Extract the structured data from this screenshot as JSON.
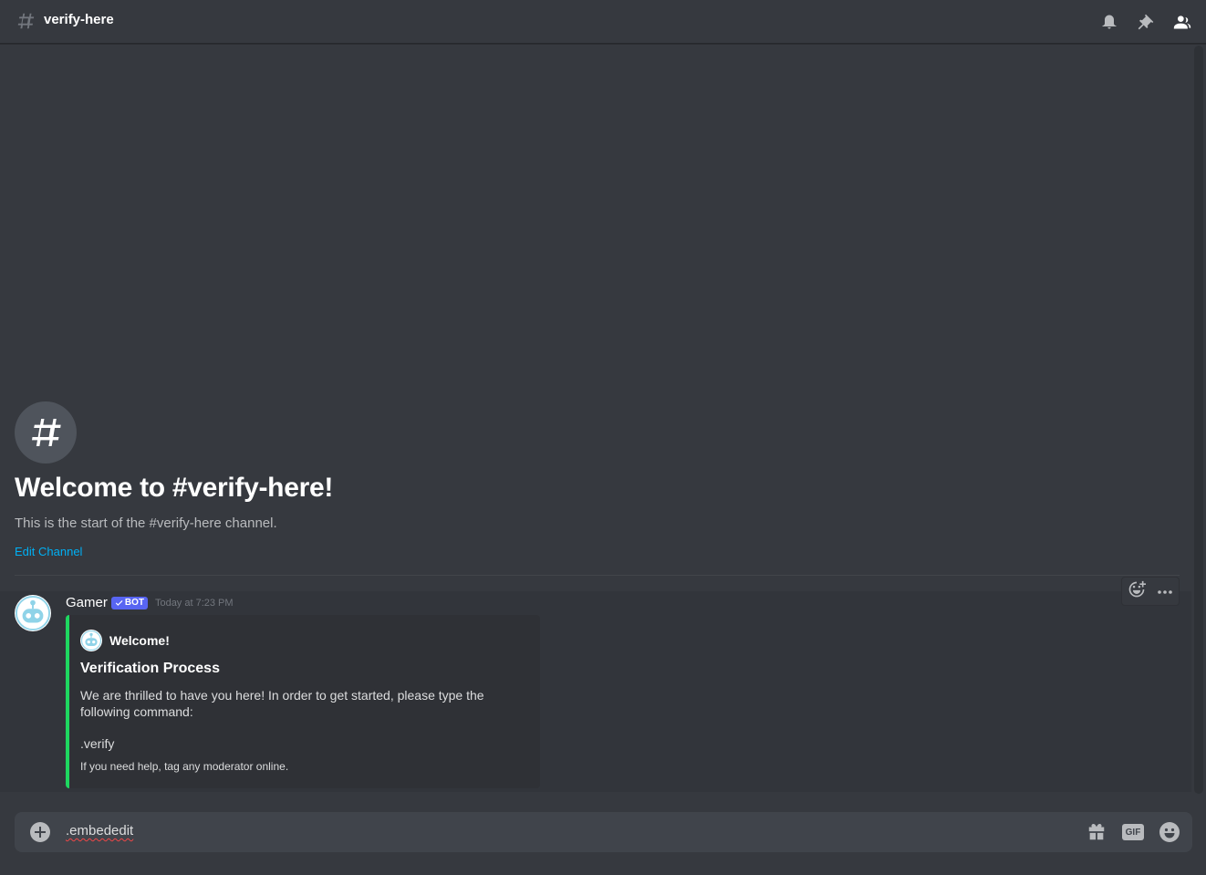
{
  "header": {
    "channel_name": "verify-here",
    "icons": [
      "hash-icon",
      "bell-icon",
      "pin-icon",
      "members-icon"
    ]
  },
  "welcome": {
    "title": "Welcome to #verify-here!",
    "subtitle": "This is the start of the #verify-here channel.",
    "edit_link": "Edit Channel"
  },
  "message": {
    "username": "Gamer",
    "badge": "BOT",
    "timestamp": "Today at 7:23 PM",
    "embed": {
      "accent_color": "#1ed760",
      "author": "Welcome!",
      "title": "Verification Process",
      "description": "We are thrilled to have you here! In order to get started, please type the following command:",
      "command": ".verify",
      "footer": "If you need help, tag any moderator online."
    }
  },
  "composer": {
    "value": ".embededit",
    "icons": [
      "add-icon",
      "gift-icon",
      "gif-icon",
      "emoji-icon"
    ],
    "gif_label": "GIF"
  },
  "colors": {
    "background": "#36393f",
    "link": "#00b0f4",
    "bot_badge": "#5865f2"
  }
}
